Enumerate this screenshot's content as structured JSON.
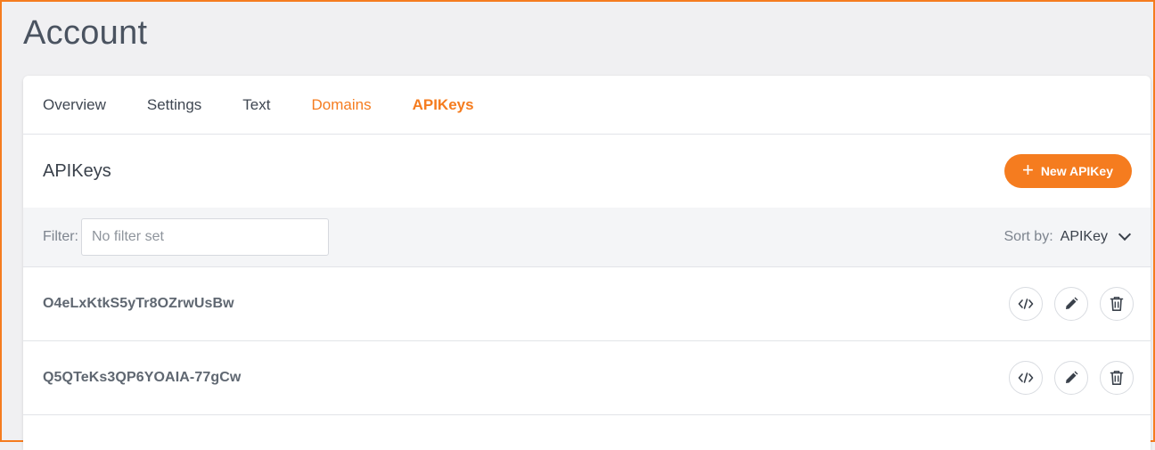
{
  "page": {
    "title": "Account"
  },
  "tabs": [
    {
      "label": "Overview"
    },
    {
      "label": "Settings"
    },
    {
      "label": "Text"
    },
    {
      "label": "Domains"
    },
    {
      "label": "APIKeys"
    }
  ],
  "section": {
    "title": "APIKeys",
    "new_button_label": "New APIKey",
    "new_button_icon": "plus-icon"
  },
  "filter": {
    "label": "Filter:",
    "placeholder": "No filter set",
    "value": ""
  },
  "sort": {
    "label": "Sort by:",
    "value": "APIKey"
  },
  "api_keys": [
    {
      "key": "O4eLxKtkS5yTr8OZrwUsBw",
      "actions": [
        "code-icon",
        "pencil-icon",
        "trash-icon"
      ]
    },
    {
      "key": "Q5QTeKs3QP6YOAIA-77gCw",
      "actions": [
        "code-icon",
        "pencil-icon",
        "trash-icon"
      ]
    }
  ],
  "colors": {
    "accent": "#f57c1f",
    "text": "#3a414b",
    "muted": "#7d848e"
  }
}
